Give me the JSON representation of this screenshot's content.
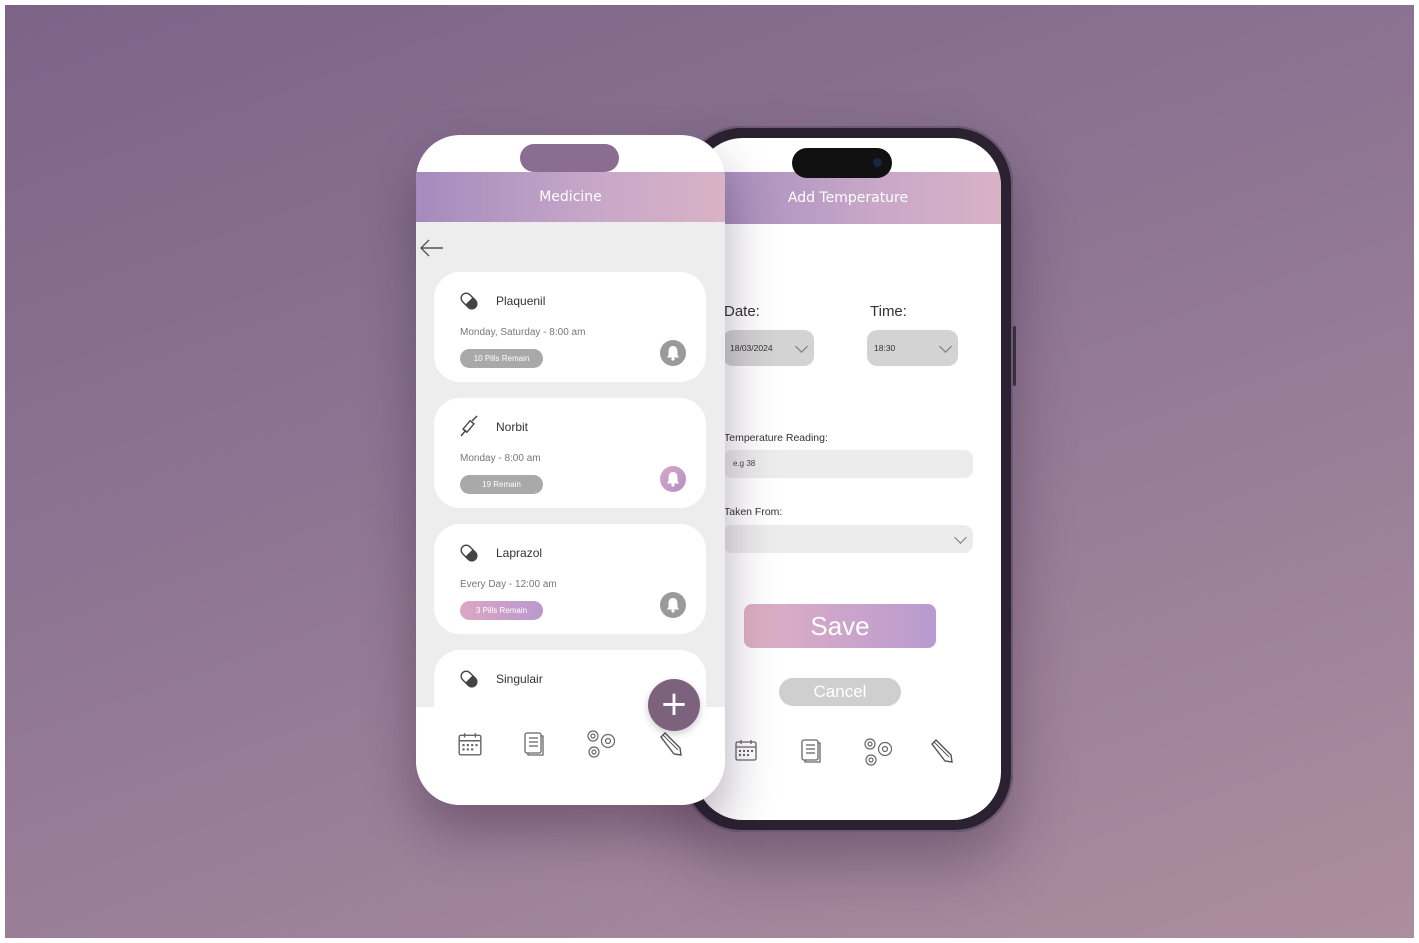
{
  "medicine_screen": {
    "title": "Medicine",
    "cards": [
      {
        "name": "Plaquenil",
        "schedule": "Monday, Saturday - 8:00 am",
        "badge": "10 Pills Remain",
        "icon": "pill-icon",
        "accent": "gray"
      },
      {
        "name": "Norbit",
        "schedule": "Monday - 8:00 am",
        "badge": "19 Remain",
        "icon": "syringe-icon",
        "accent": "pink"
      },
      {
        "name": "Laprazol",
        "schedule": "Every Day - 12:00 am",
        "badge": "3 Pills Remain",
        "icon": "pill-icon",
        "accent": "pink-badge"
      },
      {
        "name": "Singulair",
        "schedule": "",
        "badge": "",
        "icon": "pill-icon",
        "accent": "gray"
      }
    ],
    "fab_label": "+",
    "nav": [
      "calendar-icon",
      "list-icon",
      "settings-gears-icon",
      "pencil-icon"
    ]
  },
  "temperature_screen": {
    "title": "Add Temperature",
    "date_label": "Date:",
    "date_value": "18/03/2024",
    "time_label": "Time:",
    "time_value": "18:30",
    "reading_label": "Temperature Reading:",
    "reading_placeholder": "e.g 38",
    "taken_from_label": "Taken From:",
    "taken_from_value": "",
    "save_label": "Save",
    "cancel_label": "Cancel",
    "nav": [
      "calendar-icon",
      "list-icon",
      "settings-gears-icon",
      "pencil-icon"
    ]
  },
  "colors": {
    "background": "#8a7090",
    "header_gradient_start": "#a48bbd",
    "header_gradient_end": "#d9b2c6",
    "fab": "#7d627e",
    "badge_gray": "#a9a9a9"
  }
}
